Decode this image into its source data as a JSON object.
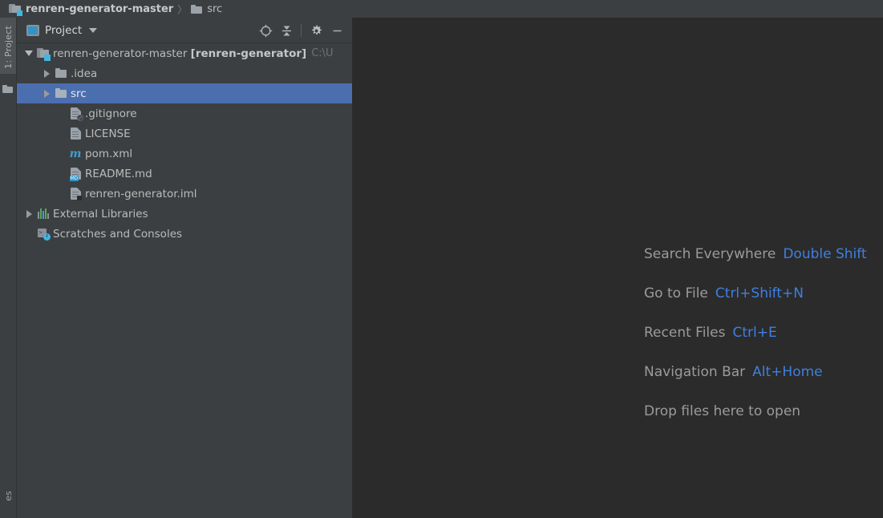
{
  "navbar": {
    "crumbs": [
      {
        "label": "renren-generator-master",
        "icon": "module-folder-icon"
      },
      {
        "label": "src",
        "icon": "folder-icon"
      }
    ],
    "separator": "〉"
  },
  "stripe": {
    "project_button": "1: Project",
    "structure_icon": "folder-icon",
    "favorites_button": "es"
  },
  "toolwindow": {
    "title": "Project",
    "title_icon": "project-window-icon",
    "dropdown_icon": "chevron-down-icon",
    "actions": [
      {
        "name": "select-opened-file",
        "icon": "locate-target-icon"
      },
      {
        "name": "collapse-all",
        "icon": "collapse-all-icon"
      },
      {
        "name": "settings",
        "icon": "gear-icon"
      },
      {
        "name": "hide",
        "icon": "minimize-icon"
      }
    ]
  },
  "tree": {
    "rows": [
      {
        "name": "project-root",
        "label": "renren-generator-master ",
        "bold_label": "[renren-generator]",
        "path": "C:\\U",
        "icon": "module-folder-icon",
        "expander": "expanded",
        "indent": 0,
        "selected": false
      },
      {
        "name": "folder-idea",
        "label": ".idea",
        "icon": "folder-icon",
        "expander": "collapsed",
        "indent": 1,
        "selected": false
      },
      {
        "name": "folder-src",
        "label": "src",
        "icon": "folder-icon",
        "expander": "collapsed",
        "indent": 1,
        "selected": true
      },
      {
        "name": "file-gitignore",
        "label": ".gitignore",
        "icon": "gitignore-file-icon",
        "expander": "none",
        "indent": 2,
        "selected": false
      },
      {
        "name": "file-license",
        "label": "LICENSE",
        "icon": "text-file-icon",
        "expander": "none",
        "indent": 2,
        "selected": false
      },
      {
        "name": "file-pom-xml",
        "label": "pom.xml",
        "icon": "maven-file-icon",
        "expander": "none",
        "indent": 2,
        "selected": false
      },
      {
        "name": "file-readme-md",
        "label": "README.md",
        "icon": "markdown-file-icon",
        "expander": "none",
        "indent": 2,
        "selected": false
      },
      {
        "name": "file-renren-generator-iml",
        "label": "renren-generator.iml",
        "icon": "iml-file-icon",
        "expander": "none",
        "indent": 2,
        "selected": false
      },
      {
        "name": "external-libraries",
        "label": "External Libraries",
        "icon": "libraries-icon",
        "expander": "collapsed",
        "indent": 0,
        "selected": false
      },
      {
        "name": "scratches-and-consoles",
        "label": "Scratches and Consoles",
        "icon": "scratches-icon",
        "expander": "none",
        "indent": 0,
        "selected": false
      }
    ]
  },
  "editor": {
    "hints": [
      {
        "action": "Search Everywhere",
        "key": "Double Shift"
      },
      {
        "action": "Go to File",
        "key": "Ctrl+Shift+N"
      },
      {
        "action": "Recent Files",
        "key": "Ctrl+E"
      },
      {
        "action": "Navigation Bar",
        "key": "Alt+Home"
      },
      {
        "action": "Drop files here to open",
        "key": ""
      }
    ]
  },
  "colors": {
    "panel_bg": "#3c3f41",
    "editor_bg": "#2b2b2b",
    "selection": "#4b6eaf",
    "accent_link": "#3f7fe0",
    "text": "#bbbbbb",
    "badge_cyan": "#40b6e0"
  }
}
